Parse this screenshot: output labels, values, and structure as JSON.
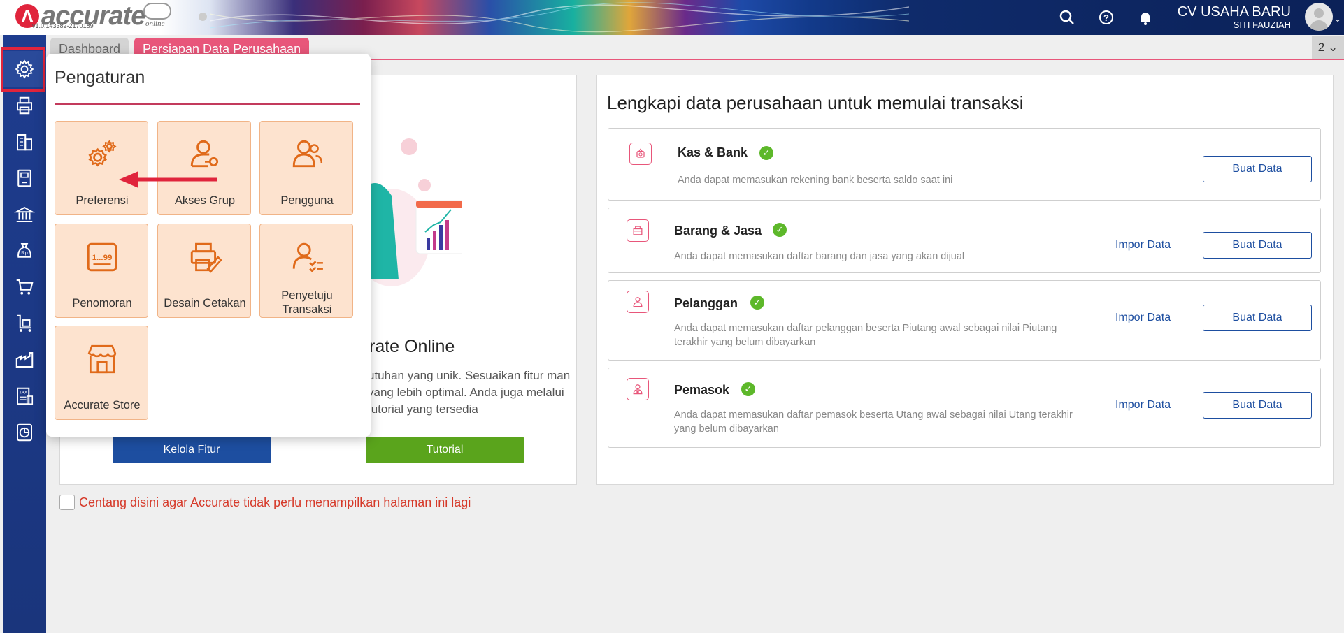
{
  "header": {
    "logo_text": "accurate",
    "logo_sub": "online",
    "version": "v1.0.1#3382-2170189",
    "company_name": "CV USAHA BARU",
    "user_name": "SITI FAUZIAH",
    "icons": [
      "search-icon",
      "help-icon",
      "bell-icon"
    ]
  },
  "tabs": {
    "dashboard": "Dashboard",
    "active": "Persiapan Data Perusahaan",
    "count": "2"
  },
  "sidebar": {
    "items": [
      "gear-icon",
      "printer-icon",
      "building-icon",
      "book-icon",
      "bank-icon",
      "money-bag-icon",
      "cart-icon",
      "trolley-icon",
      "factory-icon",
      "tax-icon",
      "report-icon"
    ]
  },
  "left_card": {
    "title": "rate Online",
    "desc": "utuhan yang unik. Sesuaikan fitur man yang lebih optimal. Anda juga melalui tutorial yang tersedia",
    "btn_fitur": "Kelola Fitur",
    "btn_tutorial": "Tutorial"
  },
  "right_card": {
    "title": "Lengkapi data perusahaan untuk memulai transaksi",
    "rows": [
      {
        "title": "Kas & Bank",
        "desc": "Anda dapat memasukan rekening bank beserta saldo saat ini",
        "impor": "",
        "buat": "Buat Data"
      },
      {
        "title": "Barang & Jasa",
        "desc": "Anda dapat memasukan daftar barang dan jasa yang akan dijual",
        "impor": "Impor Data",
        "buat": "Buat Data"
      },
      {
        "title": "Pelanggan",
        "desc": "Anda dapat memasukan daftar pelanggan beserta Piutang awal sebagai nilai Piutang terakhir yang belum dibayarkan",
        "impor": "Impor Data",
        "buat": "Buat Data"
      },
      {
        "title": "Pemasok",
        "desc": "Anda dapat memasukan daftar pemasok beserta Utang awal sebagai nilai Utang terakhir yang belum dibayarkan",
        "impor": "Impor Data",
        "buat": "Buat Data"
      }
    ]
  },
  "checkbox_label": "Centang disini agar Accurate tidak perlu menampilkan halaman ini lagi",
  "popup": {
    "title": "Pengaturan",
    "tiles": [
      "Preferensi",
      "Akses Grup",
      "Pengguna",
      "Penomoran",
      "Desain Cetakan",
      "Penyetuju Transaksi",
      "Accurate Store"
    ],
    "penomoran_glyph": "1...99"
  },
  "colors": {
    "brand_red": "#e0243c",
    "sidebar_blue": "#1e3c8e",
    "tab_pink": "#e8567a",
    "tile_bg": "#fde3cf",
    "icon_orange": "#e06a1a",
    "check_green": "#5db82a",
    "link_blue": "#1d4ea0"
  }
}
